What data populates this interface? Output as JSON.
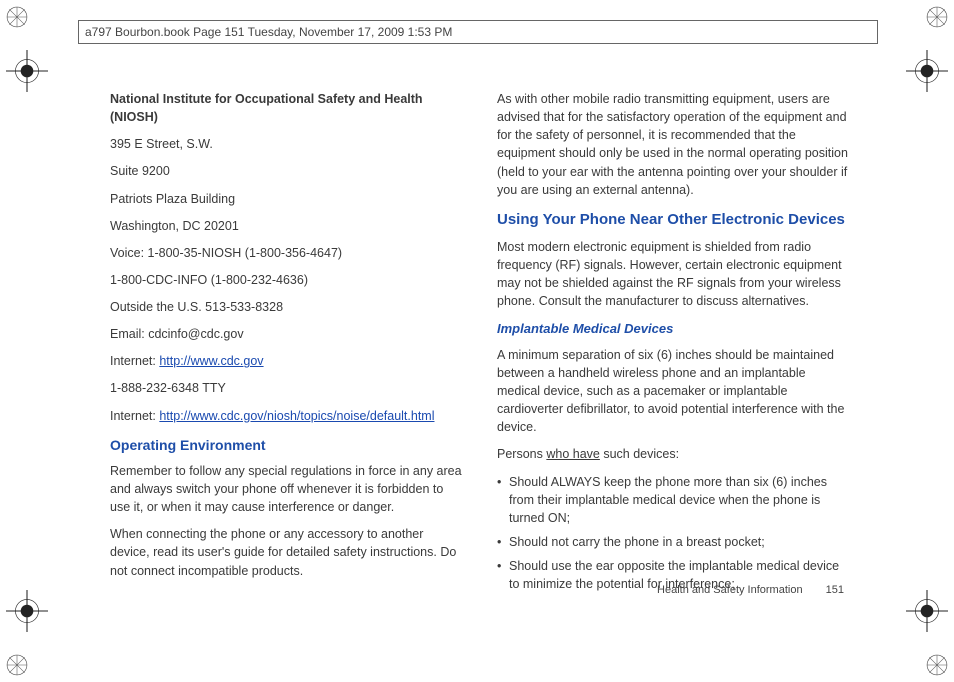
{
  "header": {
    "text": "a797 Bourbon.book  Page 151  Tuesday, November 17, 2009  1:53 PM"
  },
  "left": {
    "org_title": "National Institute for Occupational Safety and Health (NIOSH)",
    "addr1": "395 E Street, S.W.",
    "addr2": "Suite 9200",
    "addr3": "Patriots Plaza Building",
    "addr4": "Washington, DC 20201",
    "voice": "Voice: 1-800-35-NIOSH (1-800-356-4647)",
    "cdcinfo": "1-800-CDC-INFO (1-800-232-4636)",
    "outside": "Outside the U.S. 513-533-8328",
    "email": "Email: cdcinfo@cdc.gov",
    "internet1_label": "Internet: ",
    "internet1_link": "http://www.cdc.gov",
    "tty": "1-888-232-6348 TTY",
    "internet2_label": "Internet: ",
    "internet2_link": "http://www.cdc.gov/niosh/topics/noise/default.html",
    "h1": "Operating Environment",
    "p1": "Remember to follow any special regulations in force in any area and always switch your phone off whenever it is forbidden to use it, or when it may cause interference or danger.",
    "p2": "When connecting the phone or any accessory to another device, read its user's guide for detailed safety instructions. Do not connect incompatible products."
  },
  "right": {
    "p1": "As with other mobile radio transmitting equipment, users are advised that for the satisfactory operation of the equipment and for the safety of personnel, it is recommended that the equipment should only be used in the normal operating position (held to your ear with the antenna pointing over your shoulder if you are using an external antenna).",
    "h1": "Using Your Phone Near Other Electronic Devices",
    "p2": "Most modern electronic equipment is shielded from radio frequency (RF) signals. However, certain electronic equipment may not be shielded against the RF signals from your wireless phone. Consult the manufacturer to discuss alternatives.",
    "h2": "Implantable Medical Devices",
    "p3": "A minimum separation of six (6) inches should be maintained between a handheld wireless phone and an implantable medical device, such as a pacemaker or implantable cardioverter defibrillator, to avoid potential interference with the device.",
    "p4a": "Persons ",
    "p4b": "who have",
    "p4c": " such devices:",
    "b1": "Should ALWAYS keep the phone more than six (6) inches from their implantable medical device when the phone is turned ON;",
    "b2": "Should not carry the phone in a breast pocket;",
    "b3": "Should use the ear opposite the implantable medical device to minimize the potential for interference;"
  },
  "footer": {
    "section": "Health and Safety Information",
    "num": "151"
  }
}
